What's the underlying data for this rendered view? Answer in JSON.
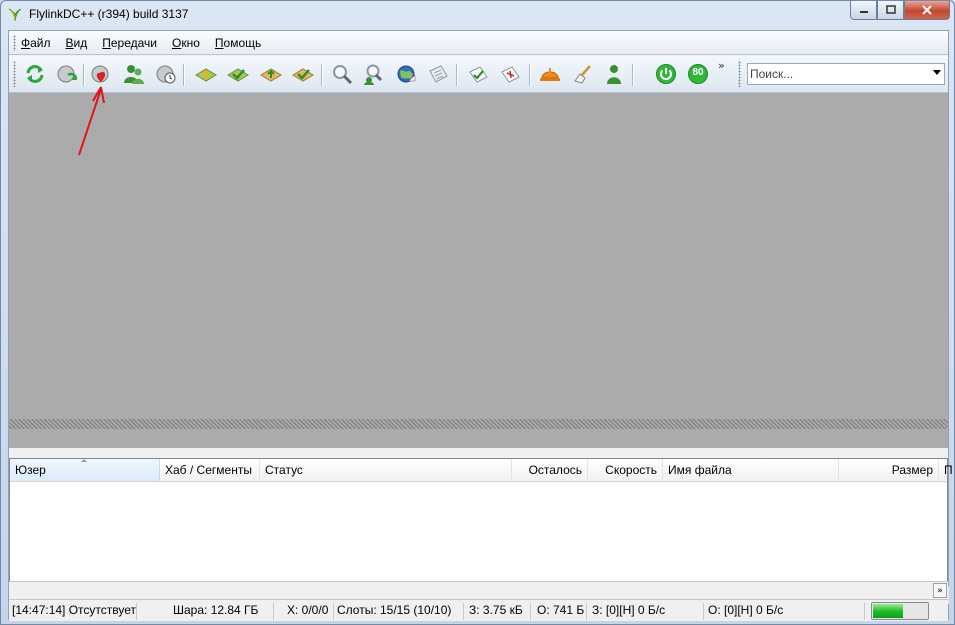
{
  "window": {
    "title": "FlylinkDC++ (r394) build 3137"
  },
  "menu": {
    "items": [
      {
        "label": "Файл",
        "accel": "Ф",
        "rest": "айл"
      },
      {
        "label": "Вид",
        "accel": "В",
        "rest": "ид"
      },
      {
        "label": "Передачи",
        "accel": "П",
        "rest": "ередачи"
      },
      {
        "label": "Окно",
        "accel": "О",
        "rest": "кно"
      },
      {
        "label": "Помощь",
        "accel": "П",
        "rest": "омощь"
      }
    ]
  },
  "toolbar": {
    "icons": [
      "reconnect-icon",
      "follow-redirect-icon",
      "favorite-hubs-icon",
      "favorite-users-icon",
      "recent-hubs-icon",
      "download-queue-icon",
      "finished-downloads-icon",
      "upload-queue-icon",
      "finished-uploads-icon",
      "search-icon",
      "search-spy-icon",
      "network-stats-icon",
      "notepad-icon",
      "adl-search-icon",
      "cdm-debug-icon",
      "settings-icon",
      "clear-icon",
      "away-icon",
      "speed-limit-icon",
      "slots-80-icon"
    ],
    "slots_badge": "80",
    "chevron": "»"
  },
  "search": {
    "placeholder": "Поиск..."
  },
  "transfers": {
    "columns": [
      "Юзер",
      "Хаб / Сегменты",
      "Статус",
      "Осталось",
      "Скорость",
      "Имя файла",
      "Размер",
      "П"
    ],
    "sorted_column": "Юзер"
  },
  "statusbar": {
    "log": "[14:47:14] Отсутствует",
    "share": "Шара: 12.84 ГБ",
    "hubs": "X: 0/0/0",
    "slots": "Слоты: 15/15 (10/10)",
    "downloaded": "З: 3.75 кБ",
    "uploaded": "О: 741 Б",
    "down_speed": "З: [0][Н] 0 Б/с",
    "up_speed": "О: [0][Н] 0 Б/с",
    "traffic_level": 0.55
  },
  "colors": {
    "mdi_background": "#ababab",
    "annotation_arrow": "#e0141e",
    "speed_green": "#1fbf2b"
  }
}
